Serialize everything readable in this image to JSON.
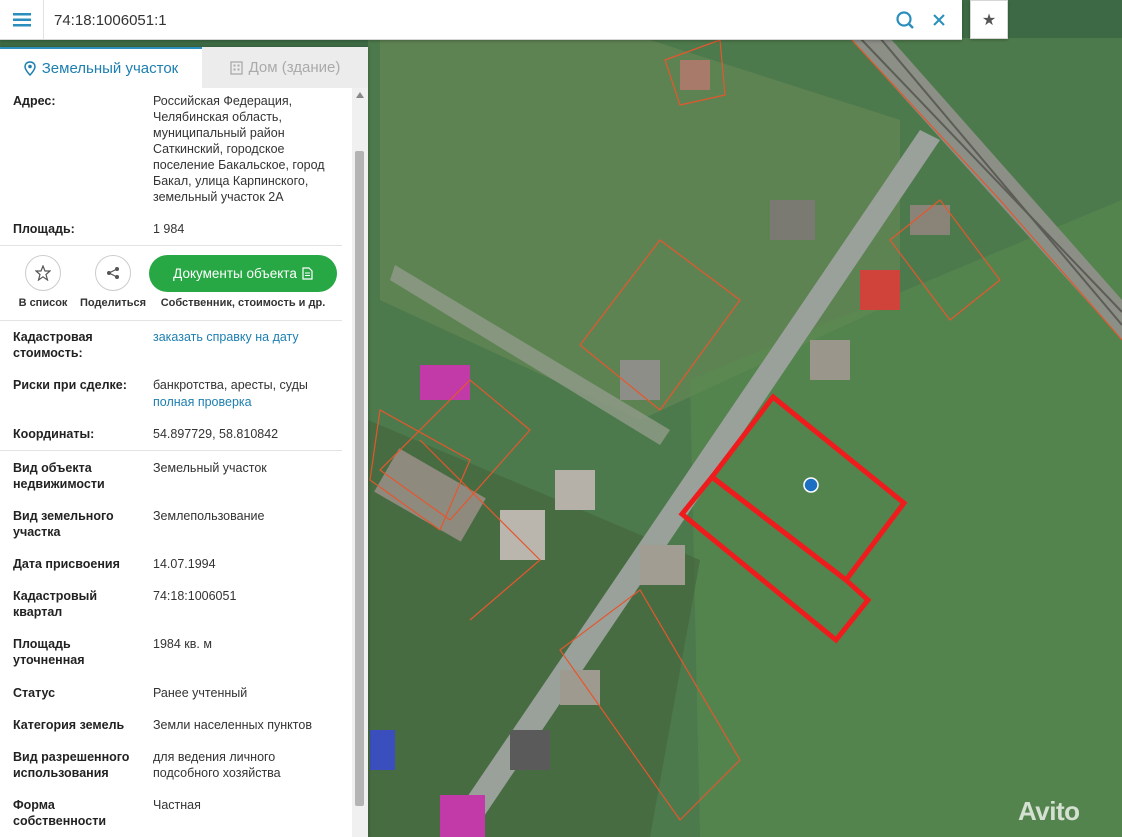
{
  "search": {
    "value": "74:18:1006051:1"
  },
  "tabs": [
    {
      "label": "Земельный участок",
      "icon": "location-pin-icon"
    },
    {
      "label": "Дом (здание)",
      "icon": "building-icon"
    }
  ],
  "info": {
    "address_label": "Адрес:",
    "address_value": "Российская Федерация, Челябинская область, муниципальный район Саткинский, городское поселение Бакальское, город Бакал, улица Карпинского, земельный участок 2А",
    "area_label": "Площадь:",
    "area_value": "1 984",
    "cadastral_cost_label": "Кадастровая стоимость:",
    "cadastral_cost_link": "заказать справку на дату",
    "risks_label": "Риски при сделке:",
    "risks_value": "банкротства, аресты, суды",
    "risks_link": "полная проверка",
    "coords_label": "Координаты:",
    "coords_value": "54.897729, 58.810842",
    "object_type_label": "Вид объекта недвижимости",
    "object_type_value": "Земельный участок",
    "land_type_label": "Вид земельного участка",
    "land_type_value": "Землепользование",
    "assign_date_label": "Дата присвоения",
    "assign_date_value": "14.07.1994",
    "quarter_label": "Кадастровый квартал",
    "quarter_value": "74:18:1006051",
    "precise_area_label": "Площадь уточненная",
    "precise_area_value": "1984 кв. м",
    "status_label": "Статус",
    "status_value": "Ранее учтенный",
    "category_label": "Категория земель",
    "category_value": "Земли населенных пунктов",
    "permitted_use_label": "Вид разрешенного использования",
    "permitted_use_value": "для ведения личного подсобного хозяйства",
    "ownership_label": "Форма собственности",
    "ownership_value": "Частная"
  },
  "actions": {
    "to_list": "В список",
    "share": "Поделиться",
    "docs_button": "Документы объекта",
    "docs_caption": "Собственник, стоимость и др."
  },
  "watermark": "Avito",
  "colors": {
    "accent": "#2a8fbd",
    "green_button": "#27a844",
    "parcel_highlight": "#ee1c1c",
    "parcel_border": "#e4572e"
  }
}
